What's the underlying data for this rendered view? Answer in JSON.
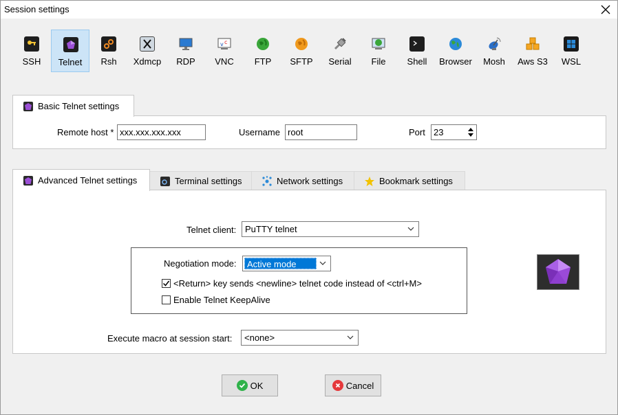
{
  "window": {
    "title": "Session settings"
  },
  "protocols": [
    {
      "label": "SSH",
      "icon": "key-icon",
      "active": false
    },
    {
      "label": "Telnet",
      "icon": "telnet-gem-icon",
      "active": true
    },
    {
      "label": "Rsh",
      "icon": "rsh-icon",
      "active": false
    },
    {
      "label": "Xdmcp",
      "icon": "xdmcp-icon",
      "active": false
    },
    {
      "label": "RDP",
      "icon": "rdp-monitor-icon",
      "active": false
    },
    {
      "label": "VNC",
      "icon": "vnc-icon",
      "active": false
    },
    {
      "label": "FTP",
      "icon": "ftp-globe-icon",
      "active": false
    },
    {
      "label": "SFTP",
      "icon": "sftp-globe-icon",
      "active": false
    },
    {
      "label": "Serial",
      "icon": "serial-plug-icon",
      "active": false
    },
    {
      "label": "File",
      "icon": "file-globe-icon",
      "active": false
    },
    {
      "label": "Shell",
      "icon": "shell-terminal-icon",
      "active": false
    },
    {
      "label": "Browser",
      "icon": "browser-globe-icon",
      "active": false
    },
    {
      "label": "Mosh",
      "icon": "mosh-satellite-icon",
      "active": false
    },
    {
      "label": "Aws S3",
      "icon": "aws-cubes-icon",
      "active": false
    },
    {
      "label": "WSL",
      "icon": "windows-logo-icon",
      "active": false
    }
  ],
  "basic": {
    "tab_label": "Basic Telnet settings",
    "remote_host_label": "Remote host *",
    "remote_host_value": "xxx.xxx.xxx.xxx",
    "username_label": "Username",
    "username_value": "root",
    "port_label": "Port",
    "port_value": "23"
  },
  "advanced_tabs": [
    {
      "label": "Advanced Telnet settings",
      "icon": "telnet-gem-icon",
      "active": true
    },
    {
      "label": "Terminal settings",
      "icon": "terminal-icon",
      "active": false
    },
    {
      "label": "Network settings",
      "icon": "network-icon",
      "active": false
    },
    {
      "label": "Bookmark settings",
      "icon": "star-icon",
      "active": false
    }
  ],
  "advanced": {
    "client_label": "Telnet client:",
    "client_value": "PuTTY telnet",
    "negotiation_label": "Negotiation mode:",
    "negotiation_value": "Active mode",
    "return_key_label": "<Return> key sends <newline> telnet code instead of <ctrl+M>",
    "return_key_checked": true,
    "keepalive_label": "Enable Telnet KeepAlive",
    "keepalive_checked": false,
    "macro_label": "Execute macro at session start:",
    "macro_value": "<none>"
  },
  "buttons": {
    "ok": "OK",
    "cancel": "Cancel"
  },
  "colors": {
    "active_bg": "#cce4f7",
    "active_border": "#99c9ef",
    "highlight": "#0078d7",
    "gem": "#9b4fd6",
    "ok": "#2fb24a",
    "cancel": "#e5383b"
  }
}
